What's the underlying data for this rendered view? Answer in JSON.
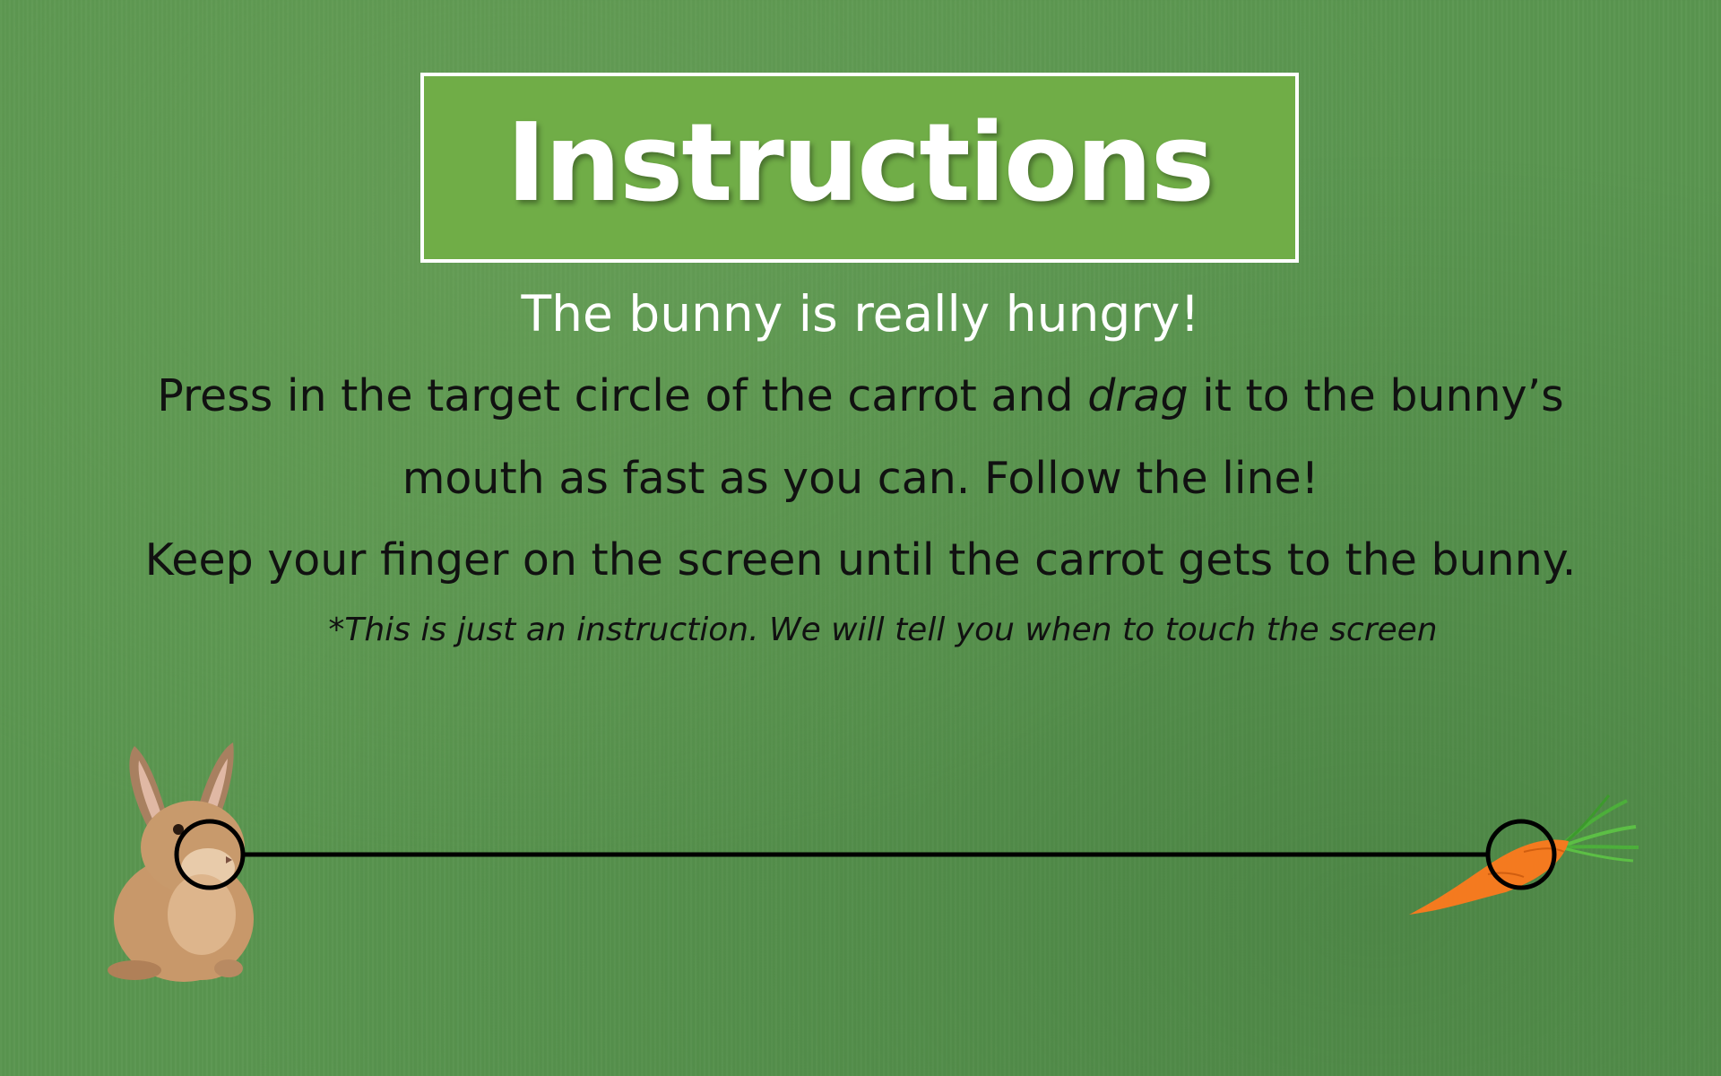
{
  "title": "Instructions",
  "subtitle": "The bunny is really hungry!",
  "instruction_line1_before": "Press in the target circle of the carrot and ",
  "instruction_line1_emphasis": "drag",
  "instruction_line1_after": " it to the bunny’s",
  "instruction_line2": "mouth as fast as you can. Follow the line!",
  "instruction_line3": "Keep your finger on the screen until the carrot gets to the bunny.",
  "note": "*This is just an instruction. We will tell you when to touch the screen",
  "colors": {
    "background": "#5a9650",
    "title_box": "#70ad47",
    "title_text": "#ffffff",
    "line": "#000000",
    "carrot": "#f47a1f",
    "carrot_leaves": "#4caf3a",
    "bunny_fur": "#c8986a"
  },
  "scene": {
    "bunny": "bunny-image",
    "carrot": "carrot-image",
    "bunny_target": "bunny-mouth-target-circle",
    "carrot_target": "carrot-target-circle",
    "path": "drag-path-line"
  }
}
